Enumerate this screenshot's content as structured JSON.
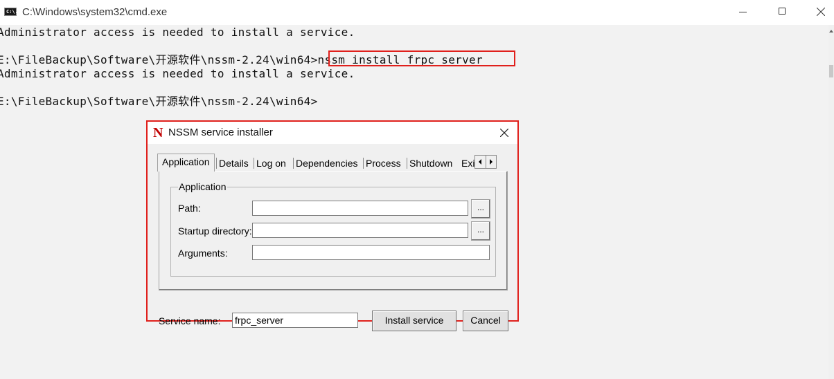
{
  "window": {
    "title": "C:\\Windows\\system32\\cmd.exe",
    "icon_text": "C:\\."
  },
  "console": {
    "lines": [
      "Administrator access is needed to install a service.",
      "",
      "E:\\FileBackup\\Software\\开源软件\\nssm-2.24\\win64>nssm install frpc_server",
      "Administrator access is needed to install a service.",
      "",
      "E:\\FileBackup\\Software\\开源软件\\nssm-2.24\\win64>"
    ]
  },
  "dialog": {
    "logo": "N",
    "title": "NSSM service installer",
    "tabs": [
      {
        "label": "Application",
        "active": true
      },
      {
        "label": "Details",
        "active": false
      },
      {
        "label": "Log on",
        "active": false
      },
      {
        "label": "Dependencies",
        "active": false
      },
      {
        "label": "Process",
        "active": false
      },
      {
        "label": "Shutdown",
        "active": false
      },
      {
        "label": "Exit",
        "active": false
      }
    ],
    "application_group": {
      "label": "Application",
      "path_label": "Path:",
      "path_value": "",
      "startup_dir_label": "Startup directory:",
      "startup_dir_value": "",
      "arguments_label": "Arguments:",
      "arguments_value": "",
      "browse_label": "..."
    },
    "service_name_label": "Service name:",
    "service_name_value": "frpc_server",
    "install_button": "Install service",
    "cancel_button": "Cancel"
  },
  "colors": {
    "highlight": "#e0201c",
    "console_bg": "#f2f2f2",
    "dialog_bg": "#f0f0f0"
  }
}
